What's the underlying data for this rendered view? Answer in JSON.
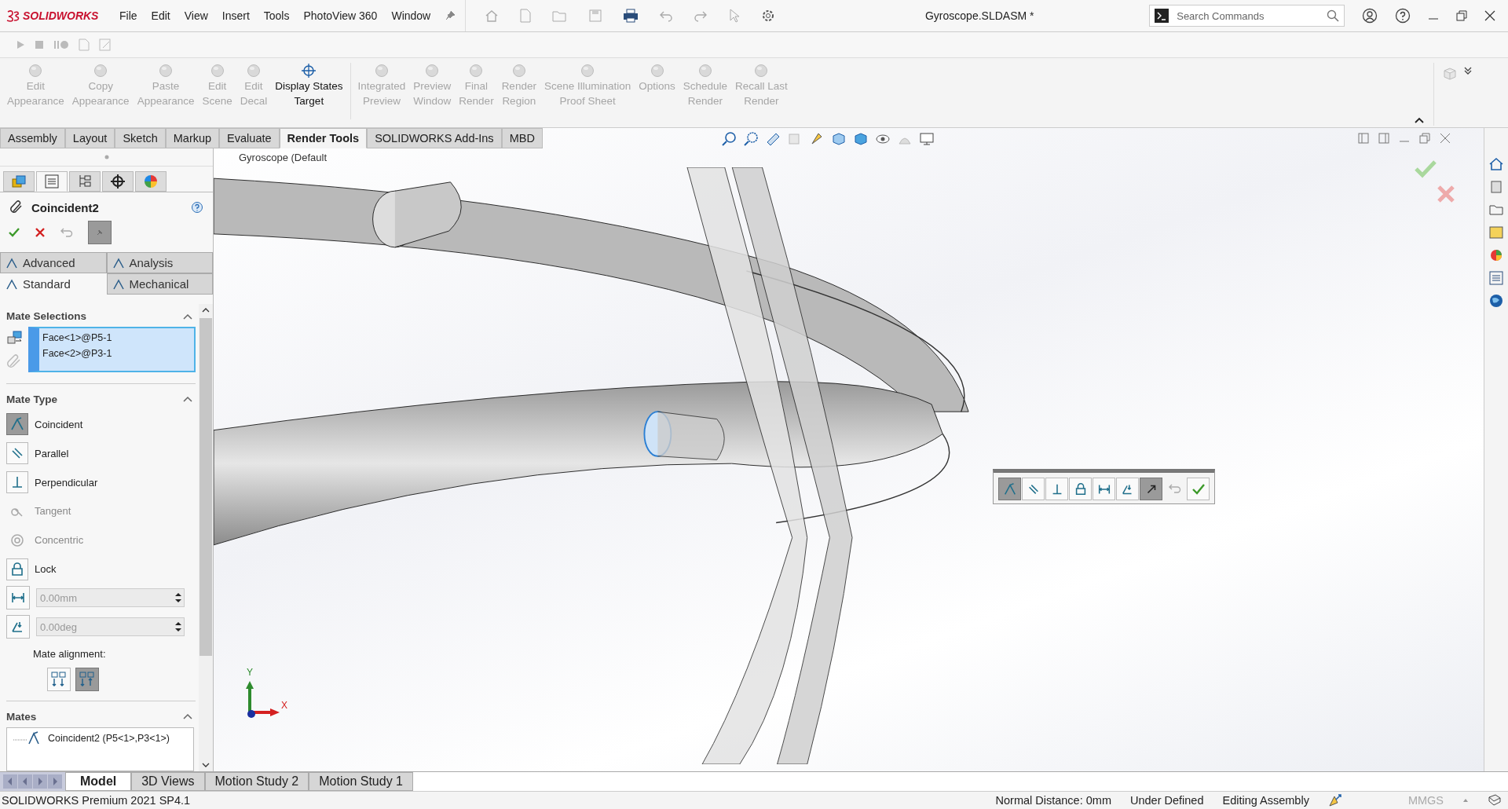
{
  "app": {
    "logo": "SOLIDWORKS",
    "menus": [
      "File",
      "Edit",
      "View",
      "Insert",
      "Tools",
      "PhotoView 360",
      "Window"
    ],
    "title": "Gyroscope.SLDASM *",
    "search": {
      "placeholder": "Search Commands"
    }
  },
  "ribbon": {
    "groups": [
      [
        {
          "lines": [
            "Edit",
            "Appearance"
          ],
          "disabled": true
        },
        {
          "lines": [
            "Copy",
            "Appearance"
          ],
          "disabled": true
        },
        {
          "lines": [
            "Paste",
            "Appearance"
          ],
          "disabled": true
        },
        {
          "lines": [
            "Edit",
            "Scene"
          ],
          "disabled": true
        },
        {
          "lines": [
            "Edit",
            "Decal"
          ],
          "disabled": true
        },
        {
          "lines": [
            "Display States",
            "Target"
          ],
          "disabled": false
        }
      ],
      [
        {
          "lines": [
            "Integrated",
            "Preview"
          ],
          "disabled": true
        },
        {
          "lines": [
            "Preview",
            "Window"
          ],
          "disabled": true
        },
        {
          "lines": [
            "Final",
            "Render"
          ],
          "disabled": true
        },
        {
          "lines": [
            "Render",
            "Region"
          ],
          "disabled": true
        },
        {
          "lines": [
            "Scene Illumination",
            "Proof Sheet"
          ],
          "disabled": true
        },
        {
          "lines": [
            "Options"
          ],
          "disabled": true
        },
        {
          "lines": [
            "Schedule",
            "Render"
          ],
          "disabled": true
        },
        {
          "lines": [
            "Recall Last",
            "Render"
          ],
          "disabled": true
        }
      ]
    ]
  },
  "command_tabs": [
    {
      "label": "Assembly",
      "selected": false
    },
    {
      "label": "Layout",
      "selected": false
    },
    {
      "label": "Sketch",
      "selected": false
    },
    {
      "label": "Markup",
      "selected": false
    },
    {
      "label": "Evaluate",
      "selected": false
    },
    {
      "label": "Render Tools",
      "selected": true
    },
    {
      "label": "SOLIDWORKS Add-Ins",
      "selected": false
    },
    {
      "label": "MBD",
      "selected": false
    }
  ],
  "property_manager": {
    "title": "Coincident2",
    "mate_tabs": [
      {
        "label": "Advanced",
        "selected": false
      },
      {
        "label": "Analysis",
        "selected": false
      },
      {
        "label": "Standard",
        "selected": true
      },
      {
        "label": "Mechanical",
        "selected": false
      }
    ],
    "mate_selections": {
      "title": "Mate Selections",
      "expanded": true,
      "items": [
        "Face<1>@P5-1",
        "Face<2>@P3-1"
      ]
    },
    "mate_type": {
      "title": "Mate Type",
      "expanded": true,
      "options": [
        {
          "kind": "toggle",
          "label": "Coincident",
          "selected": true,
          "disabled": false
        },
        {
          "kind": "toggle",
          "label": "Parallel",
          "selected": false,
          "disabled": false
        },
        {
          "kind": "toggle",
          "label": "Perpendicular",
          "selected": false,
          "disabled": false
        },
        {
          "kind": "toggle",
          "label": "Tangent",
          "selected": false,
          "disabled": true
        },
        {
          "kind": "toggle",
          "label": "Concentric",
          "selected": false,
          "disabled": true
        },
        {
          "kind": "toggle",
          "label": "Lock",
          "selected": false,
          "disabled": false
        },
        {
          "kind": "field",
          "value": "0.00mm",
          "disabled": true
        },
        {
          "kind": "field",
          "value": "0.00deg",
          "disabled": true
        }
      ],
      "alignment_label": "Mate alignment:",
      "alignment": [
        {
          "selected": false
        },
        {
          "selected": true
        }
      ]
    },
    "mates": {
      "title": "Mates",
      "expanded": true,
      "items": [
        "Coincident2 (P5<1>,P3<1>)"
      ]
    }
  },
  "viewport": {
    "tree_label": "Gyroscope  (Default",
    "axes": {
      "x": "X",
      "y": "Y"
    },
    "mate_toolbar": [
      {
        "selected": true
      },
      {
        "selected": false
      },
      {
        "selected": false
      },
      {
        "selected": false
      },
      {
        "selected": false
      },
      {
        "selected": false
      },
      {
        "selected": true
      },
      {
        "selected": false
      },
      {
        "selected": false
      }
    ]
  },
  "bottom_tabs": [
    {
      "label": "Model",
      "selected": true
    },
    {
      "label": "3D Views",
      "selected": false
    },
    {
      "label": "Motion Study 2",
      "selected": false
    },
    {
      "label": "Motion Study 1",
      "selected": false
    }
  ],
  "status_bar": {
    "product": "SOLIDWORKS Premium 2021 SP4.1",
    "fields": [
      "Normal Distance: 0mm",
      "Under Defined",
      "Editing Assembly"
    ],
    "units": "MMGS"
  }
}
